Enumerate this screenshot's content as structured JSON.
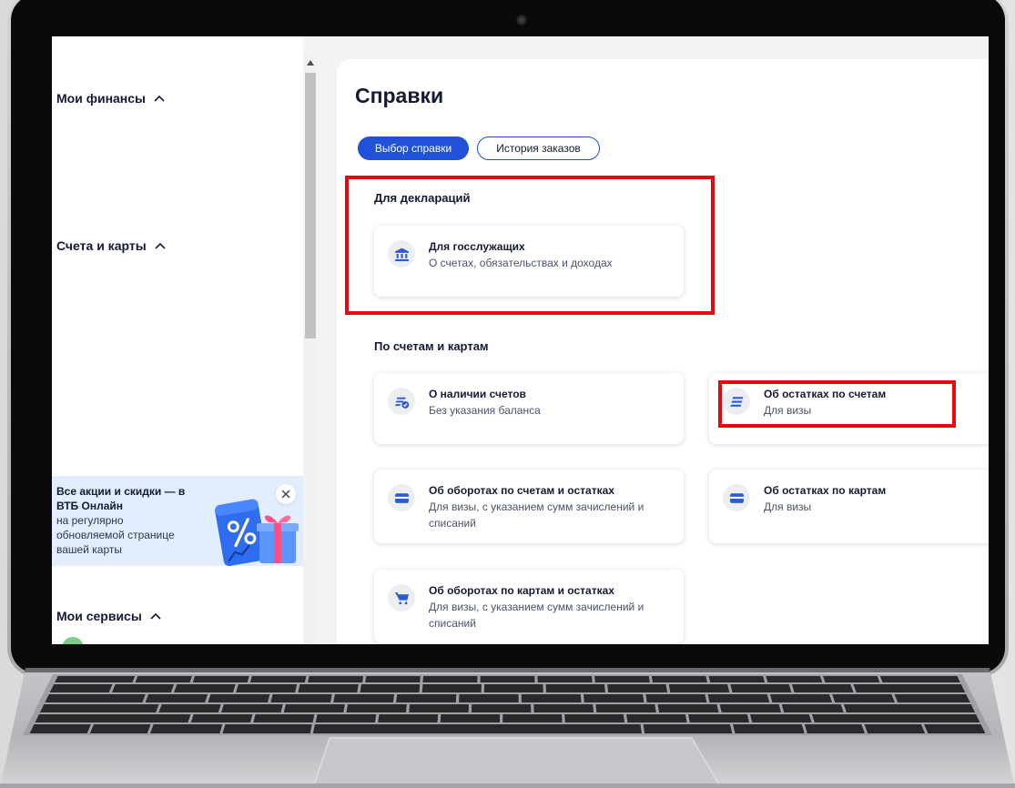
{
  "sidebar": {
    "sections": [
      {
        "label": "Мои финансы",
        "expanded": true
      },
      {
        "label": "Счета и карты",
        "expanded": true
      },
      {
        "label": "Мои сервисы",
        "expanded": true
      }
    ],
    "promo": {
      "title_lines": [
        "Все акции и скидки — в",
        "ВТБ Онлайн"
      ],
      "text_lines": [
        "на регулярно",
        "обновляемой странице",
        "вашей карты"
      ],
      "close_icon": "close-icon"
    }
  },
  "main": {
    "title": "Справки",
    "tabs": [
      {
        "label": "Выбор справки",
        "active": true
      },
      {
        "label": "История заказов",
        "active": false
      }
    ],
    "groups": [
      {
        "title": "Для деклараций",
        "items": [
          {
            "title": "Для госслужащих",
            "subtitle": "О счетах, обязательствах и доходах",
            "icon": "bank-icon",
            "highlighted": true
          }
        ]
      },
      {
        "title": "По счетам и картам",
        "items": [
          {
            "title": "О наличии счетов",
            "subtitle": "Без указания баланса",
            "icon": "accounts-check-icon",
            "highlighted": false
          },
          {
            "title": "Об остатках по счетам",
            "subtitle": "Для визы",
            "icon": "balance-lines-icon",
            "highlighted": true
          },
          {
            "title": "Об оборотах по счетам и остатках",
            "subtitle": "Для визы, с указанием сумм зачислений и списаний",
            "icon": "card-icon",
            "highlighted": false
          },
          {
            "title": "Об остатках по картам",
            "subtitle": "Для визы",
            "icon": "card-icon",
            "highlighted": false
          },
          {
            "title": "Об оборотах по картам и остатках",
            "subtitle": "Для визы, с указанием сумм зачислений и списаний",
            "icon": "cart-icon",
            "highlighted": false
          }
        ]
      }
    ]
  },
  "annotations": {
    "highlight_color": "#e8070f"
  },
  "colors": {
    "accent": "#2151d6",
    "icon": "#2b5ad9",
    "promo_background": "#e2eefe",
    "text": "#141a33",
    "bezel": "#0a0a0b"
  }
}
